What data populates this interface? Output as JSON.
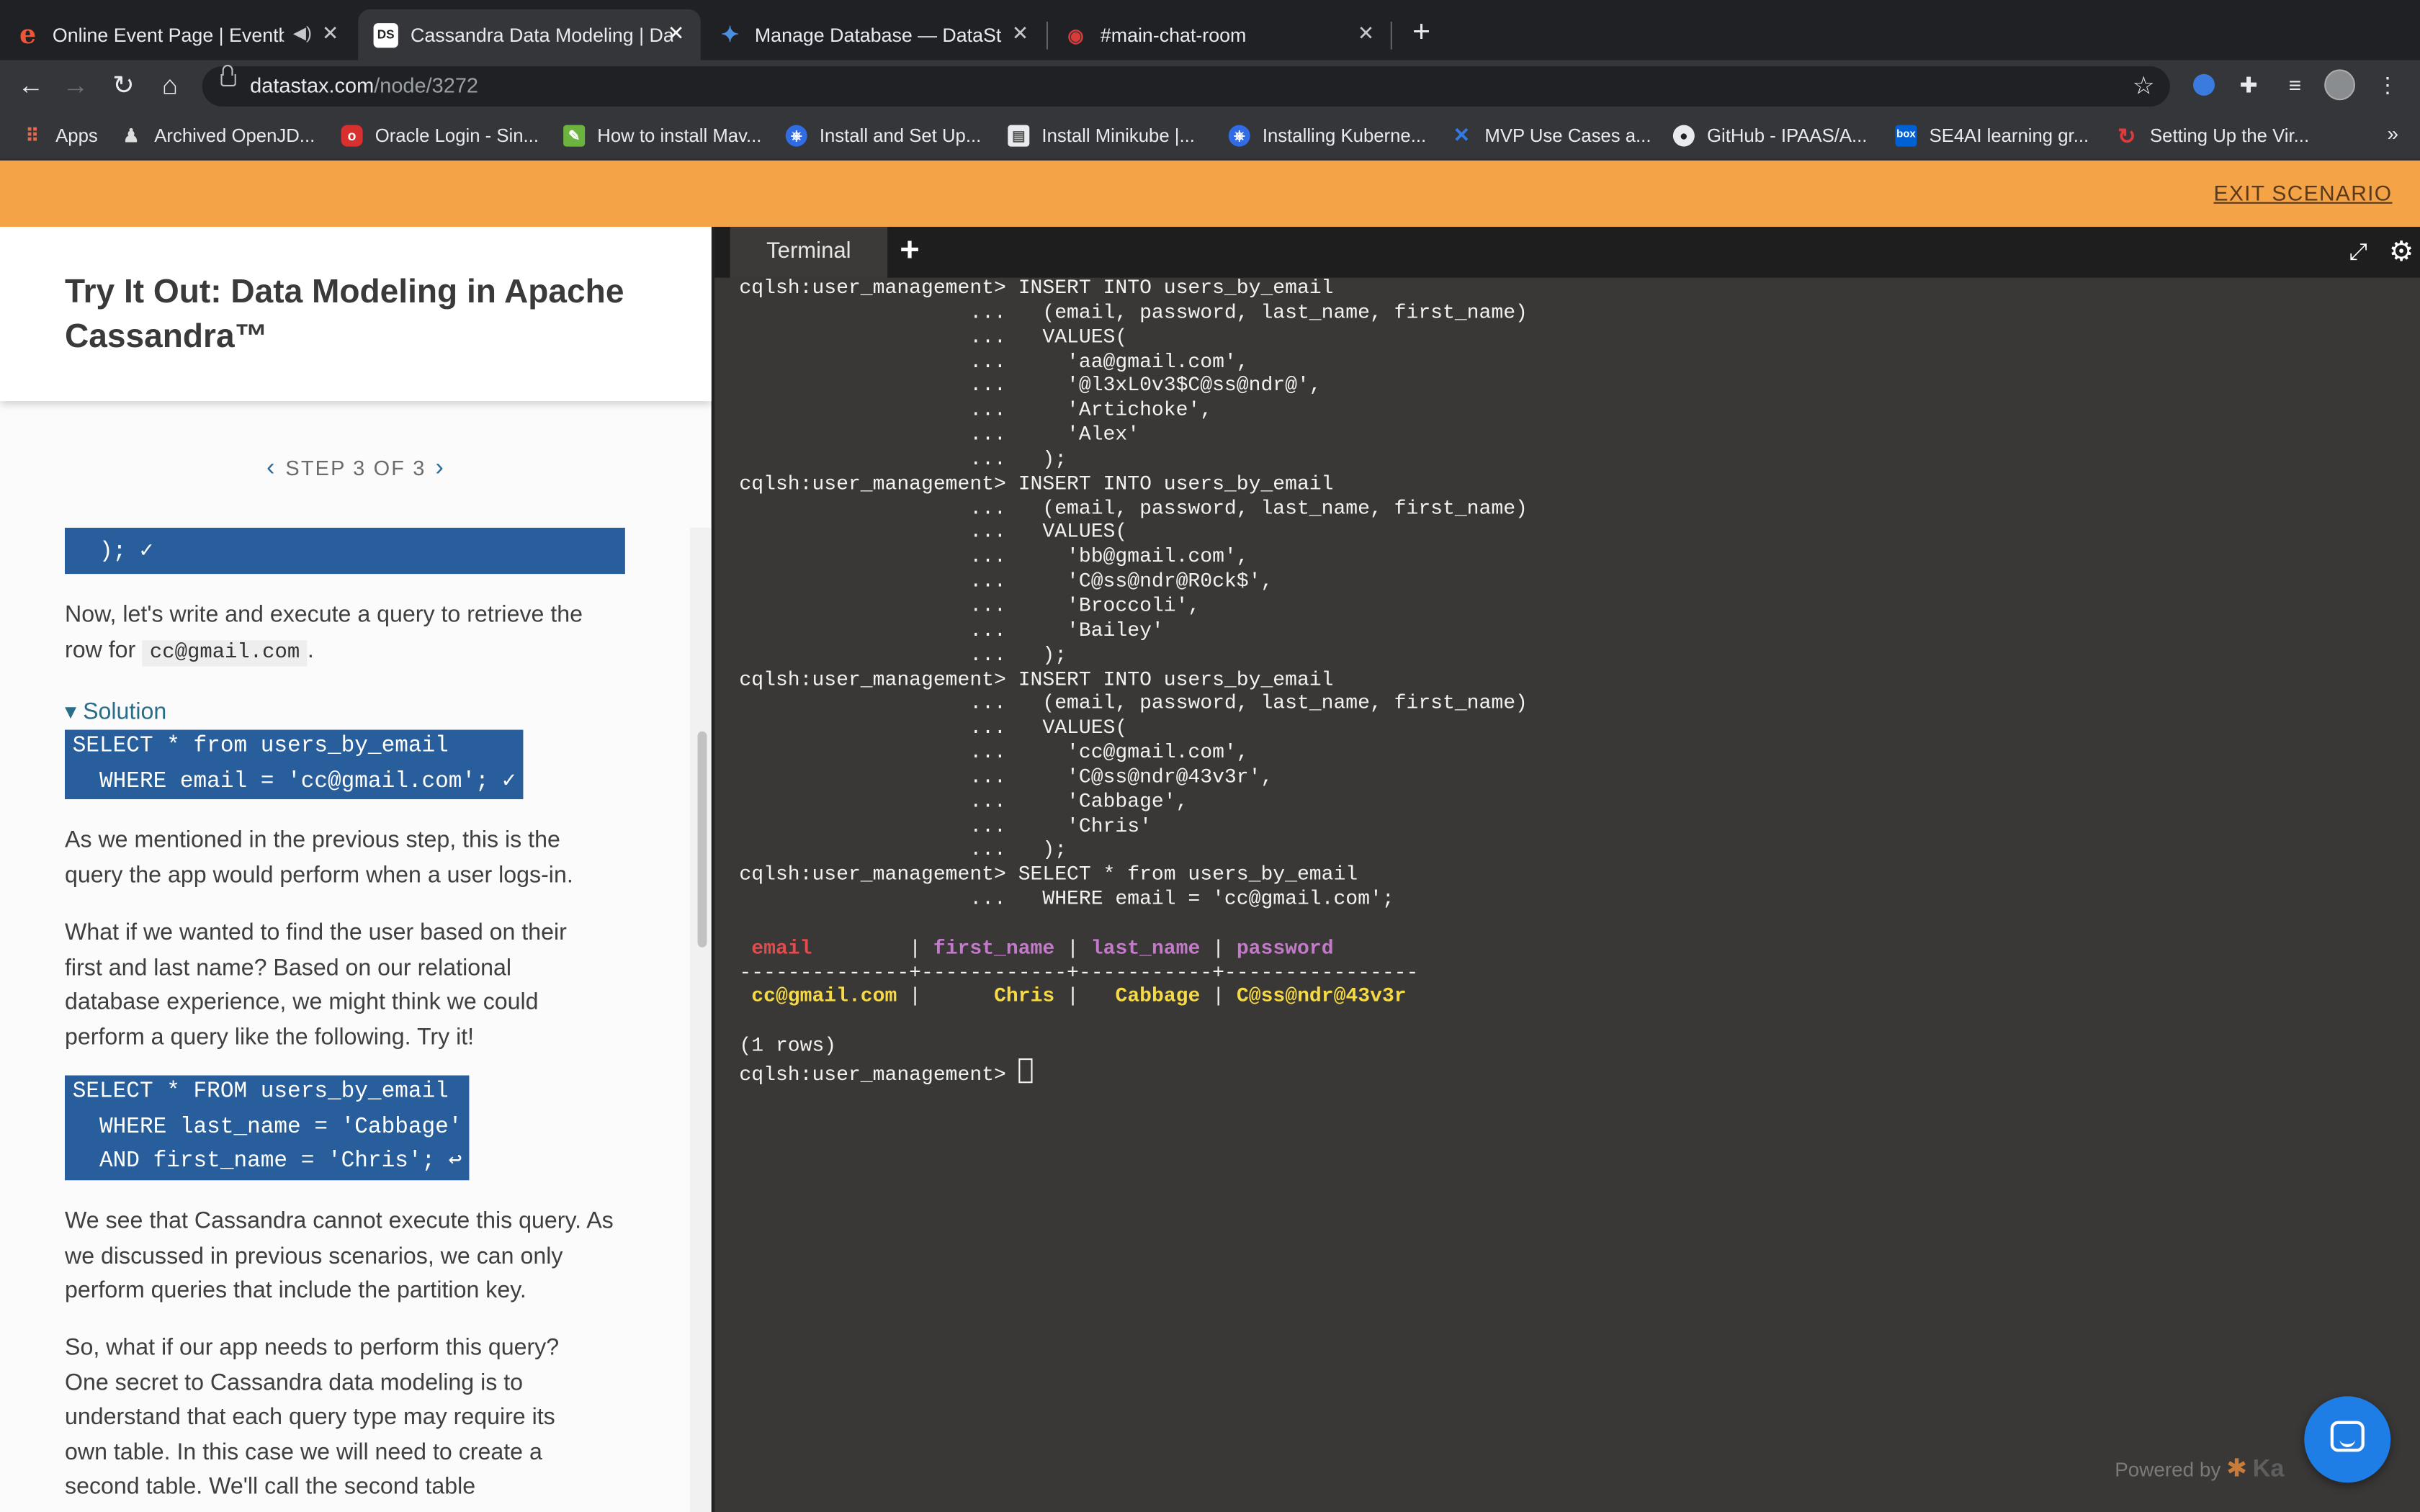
{
  "browser": {
    "tabs": [
      {
        "title": "Online Event Page | Eventb",
        "fav": "e",
        "fav_color": "#f05537"
      },
      {
        "title": "Cassandra Data Modeling | Dat",
        "fav": "DS",
        "fav_color": "#ffffff"
      },
      {
        "title": "Manage Database — DataStax",
        "fav": "✦",
        "fav_color": "#4a8fe0"
      },
      {
        "title": "#main-chat-room",
        "fav": "◉",
        "fav_color": "#d93a3a"
      }
    ],
    "url_host": "datastax.com",
    "url_path": "/node/3272",
    "bookmarks": [
      "Apps",
      "Archived OpenJD...",
      "Oracle Login - Sin...",
      "How to install Mav...",
      "Install and Set Up...",
      "Install Minikube |...",
      "Installing Kuberne...",
      "MVP Use Cases a...",
      "GitHub - IPAAS/A...",
      "SE4AI learning gr...",
      "Setting Up the Vir..."
    ],
    "bookmarks_more": "»"
  },
  "scenario": {
    "exit_label": "EXIT SCENARIO"
  },
  "lesson": {
    "title": "Try It Out: Data Modeling in Apache Cassandra™",
    "step_label": "STEP 3 OF 3",
    "code_top_line1": "  ); ✓",
    "para1_a": "Now, let's write and execute a query to retrieve the row for",
    "para1_code": "cc@gmail.com",
    "para1_b": ".",
    "solution_label": "▾ Solution",
    "solution_code": "SELECT * from users_by_email\n  WHERE email = 'cc@gmail.com'; ✓",
    "para2": "As we mentioned in the previous step, this is the query the app would perform when a user logs-in.",
    "para3": "What if we wanted to find the user based on their first and last name? Based on our relational database experience, we might think we could perform a query like the following. Try it!",
    "try_code": "SELECT * FROM users_by_email\n  WHERE last_name = 'Cabbage'\n  AND first_name = 'Chris'; ↩",
    "para4": "We see that Cassandra cannot execute this query. As we discussed in previous scenarios, we can only perform queries that include the partition key.",
    "para5": "So, what if our app needs to perform this query? One secret to Cassandra data modeling is to understand that each query type may require its own table. In this case we will need to create a second table. We'll call the second table"
  },
  "terminal": {
    "tab_label": "Terminal",
    "lines": [
      "cqlsh:user_management> INSERT INTO users_by_email",
      "                   ...   (email, password, last_name, first_name)",
      "                   ...   VALUES(",
      "                   ...     'aa@gmail.com',",
      "                   ...     '@l3xL0v3$C@ss@ndr@',",
      "                   ...     'Artichoke',",
      "                   ...     'Alex'",
      "                   ...   );",
      "cqlsh:user_management> INSERT INTO users_by_email",
      "                   ...   (email, password, last_name, first_name)",
      "                   ...   VALUES(",
      "                   ...     'bb@gmail.com',",
      "                   ...     'C@ss@ndr@R0ck$',",
      "                   ...     'Broccoli',",
      "                   ...     'Bailey'",
      "                   ...   );",
      "cqlsh:user_management> INSERT INTO users_by_email",
      "                   ...   (email, password, last_name, first_name)",
      "                   ...   VALUES(",
      "                   ...     'cc@gmail.com',",
      "                   ...     'C@ss@ndr@43v3r',",
      "                   ...     'Cabbage',",
      "                   ...     'Chris'",
      "                   ...   );",
      "cqlsh:user_management> SELECT * from users_by_email",
      "                   ...   WHERE email = 'cc@gmail.com';"
    ],
    "result_headers": [
      "email",
      "first_name",
      "last_name",
      "password"
    ],
    "result_separator": "--------------+------------+-----------+----------------",
    "result_row": [
      "cc@gmail.com",
      "Chris",
      "Cabbage",
      "C@ss@ndr@43v3r"
    ],
    "row_count": "(1 rows)",
    "prompt": "cqlsh:user_management> ",
    "powered_by": "Powered by"
  }
}
